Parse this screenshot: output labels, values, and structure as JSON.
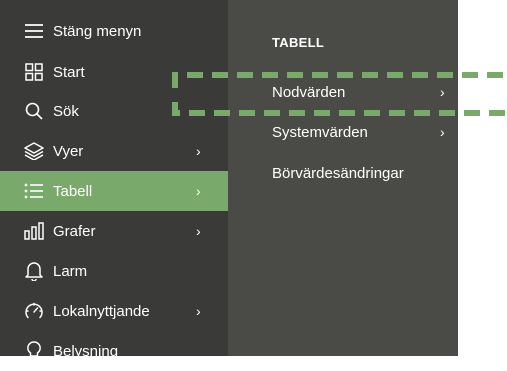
{
  "sidebar": {
    "items": [
      {
        "label": "Stäng menyn",
        "icon": "hamburger-icon",
        "chevron": ""
      },
      {
        "label": "Start",
        "icon": "grid-icon",
        "chevron": ""
      },
      {
        "label": "Sök",
        "icon": "search-icon",
        "chevron": ""
      },
      {
        "label": "Vyer",
        "icon": "layers-icon",
        "chevron": "›"
      },
      {
        "label": "Tabell",
        "icon": "list-icon",
        "chevron": "›",
        "active": true
      },
      {
        "label": "Grafer",
        "icon": "bar-chart-icon",
        "chevron": "›"
      },
      {
        "label": "Larm",
        "icon": "bell-icon",
        "chevron": ""
      },
      {
        "label": "Lokalnyttjande",
        "icon": "gauge-icon",
        "chevron": "›"
      },
      {
        "label": "Belysning",
        "icon": "bulb-icon",
        "chevron": ""
      }
    ]
  },
  "submenu": {
    "title": "TABELL",
    "items": [
      {
        "label": "Nodvärden",
        "chevron": "›"
      },
      {
        "label": "Systemvärden",
        "chevron": "›"
      },
      {
        "label": "Börvärdesändringar",
        "chevron": ""
      }
    ]
  },
  "colors": {
    "sidebar_bg": "#3a3a38",
    "submenu_bg": "#4a4a47",
    "accent": "#79a96b",
    "text": "#ffffff"
  }
}
